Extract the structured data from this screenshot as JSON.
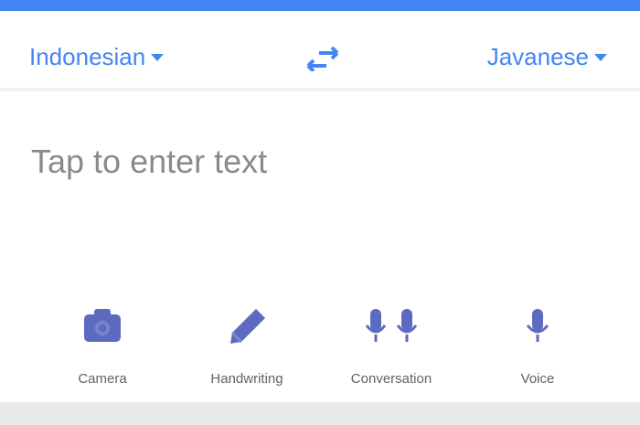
{
  "colors": {
    "accent": "#4285f4",
    "icon": "#5c6bc0",
    "placeholder": "#8a8a8a"
  },
  "languages": {
    "source": "Indonesian",
    "target": "Javanese",
    "swap_icon": "swap-arrows-icon"
  },
  "input": {
    "placeholder": "Tap to enter text"
  },
  "tools": [
    {
      "label": "Camera",
      "icon": "camera-icon"
    },
    {
      "label": "Handwriting",
      "icon": "pen-icon"
    },
    {
      "label": "Conversation",
      "icon": "dual-mic-icon"
    },
    {
      "label": "Voice",
      "icon": "mic-icon"
    }
  ]
}
